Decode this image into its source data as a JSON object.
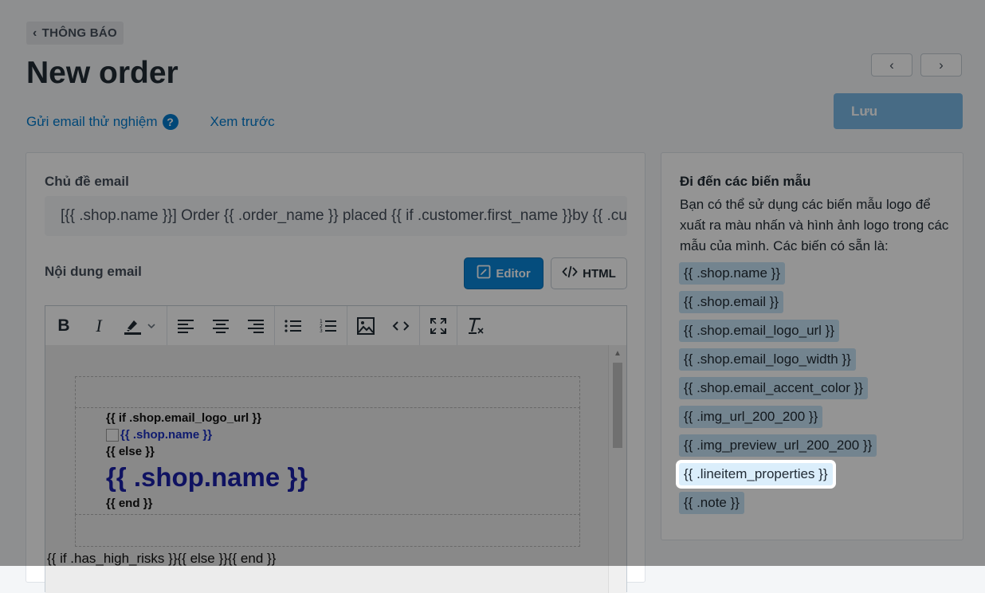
{
  "header": {
    "back_label": "THÔNG BÁO",
    "title": "New order",
    "prev_icon": "‹",
    "next_icon": "›",
    "test_email_link": "Gửi email thử nghiệm",
    "help_icon": "?",
    "preview_link": "Xem trước",
    "save_label": "Lưu"
  },
  "form": {
    "subject_label": "Chủ đề email",
    "subject_value": "[{{ .shop.name }}] Order {{ .order_name }} placed {{ if .customer.first_name }}by {{ .customer.first_name }}{{ end }}",
    "content_label": "Nội dung email",
    "editor_label": "Editor",
    "html_label": "HTML"
  },
  "editor": {
    "toolbar": [
      "bold",
      "italic",
      "highlight",
      "align-left",
      "align-center",
      "align-right",
      "bullet-list",
      "numbered-list",
      "image",
      "code",
      "fullscreen",
      "clear-format"
    ],
    "content": {
      "if_logo": "{{ if .shop.email_logo_url }}",
      "img_alt": "{{ .shop.name }}",
      "else": "{{ else }}",
      "shop_name": "{{ .shop.name }}",
      "end": "{{ end }}",
      "footer_line": "{{ if .has_high_risks }}{{ else }}{{ end }}"
    }
  },
  "sidebar": {
    "title": "Đi đến các biến mẫu",
    "description": "Bạn có thể sử dụng các biến mẫu logo để xuất ra màu nhấn và hình ảnh logo trong các mẫu của mình. Các biến có sẵn là:",
    "variables": [
      "{{ .shop.name }}",
      "{{ .shop.email }}",
      "{{ .shop.email_logo_url }}",
      "{{ .shop.email_logo_width }}",
      "{{ .shop.email_accent_color }}",
      "{{ .img_url_200_200 }}",
      "{{ .img_preview_url_200_200 }}",
      "{{ .lineitem_properties }}",
      "{{ .note }}"
    ],
    "highlighted_index": 7
  }
}
